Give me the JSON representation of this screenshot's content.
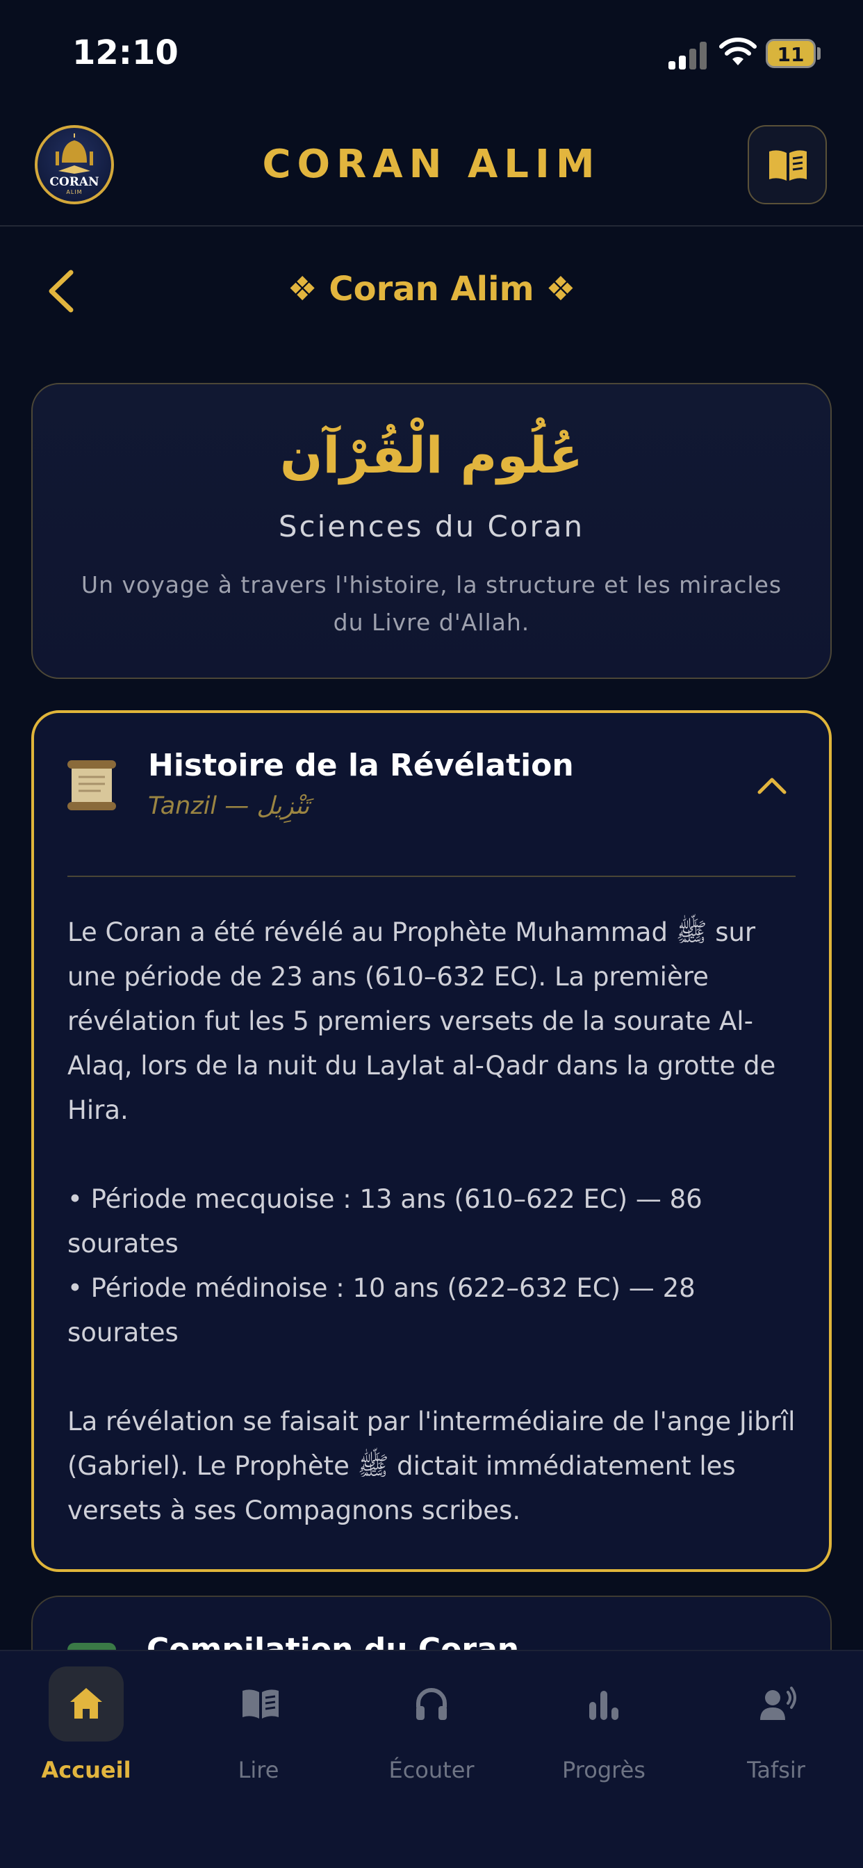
{
  "status_bar": {
    "time": "12:10",
    "battery": "11"
  },
  "header": {
    "app_title": "CORAN ALIM",
    "logo_text": "CORAN",
    "logo_subtext": "ALIM"
  },
  "nav": {
    "page_title": "❖ Coran Alim ❖"
  },
  "intro": {
    "arabic_title": "عُلُوم الْقُرْآن",
    "subtitle": "Sciences du Coran",
    "description": "Un voyage à travers l'histoire, la structure et les miracles du Livre d'Allah."
  },
  "section": {
    "title": "Histoire de la Révélation",
    "subtitle": "Tanzil — تَنْزِيل",
    "paragraphs": [
      "Le Coran a été révélé au Prophète Muhammad ﷺ sur une période de 23 ans (610–632 EC). La première révélation fut les 5 premiers versets de la sourate Al-Alaq, lors de la nuit du Laylat al-Qadr dans la grotte de Hira.",
      "",
      "• Période mecquoise : 13 ans (610–622 EC) — 86 sourates",
      "• Période médinoise : 10 ans (622–632 EC) — 28 sourates",
      "",
      "La révélation se faisait par l'intermédiaire de l'ange Jibrîl (Gabriel). Le Prophète ﷺ dictait immédiatement les versets à ses Compagnons scribes."
    ]
  },
  "next_section": {
    "title": "Compilation du Coran"
  },
  "tabs": [
    {
      "label": "Accueil",
      "icon": "home-icon",
      "active": true
    },
    {
      "label": "Lire",
      "icon": "book-icon",
      "active": false
    },
    {
      "label": "Écouter",
      "icon": "headphones-icon",
      "active": false
    },
    {
      "label": "Progrès",
      "icon": "chart-icon",
      "active": false
    },
    {
      "label": "Tafsir",
      "icon": "speaker-icon",
      "active": false
    }
  ],
  "colors": {
    "gold": "#e2b53e",
    "background": "#070d1e",
    "card": "#0d1430",
    "inactive": "#6e7484"
  }
}
